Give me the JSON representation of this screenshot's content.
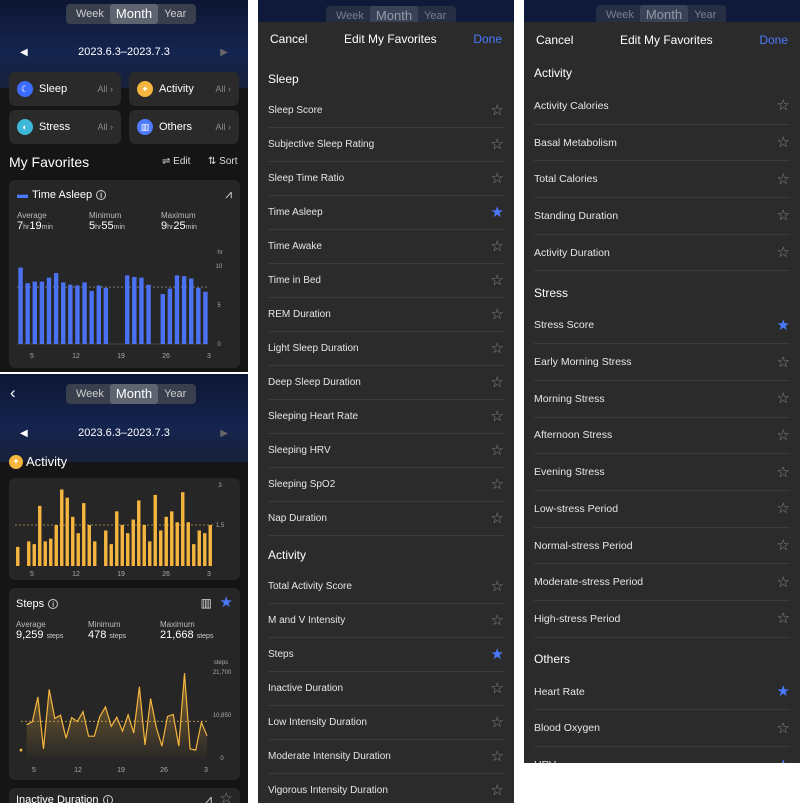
{
  "segments": [
    "Week",
    "Month",
    "Year"
  ],
  "active_segment": "Month",
  "date_range": "2023.6.3–2023.7.3",
  "categories": [
    {
      "label": "Sleep",
      "all": "All",
      "icon": "moon-icon",
      "color": "#3d6dff"
    },
    {
      "label": "Activity",
      "all": "All",
      "icon": "runner-icon",
      "color": "#f5b53f"
    },
    {
      "label": "Stress",
      "all": "All",
      "icon": "stress-icon",
      "color": "#3fb7d9"
    },
    {
      "label": "Others",
      "all": "All",
      "icon": "bars-icon",
      "color": "#4f7bff"
    }
  ],
  "favorites": {
    "title": "My Favorites",
    "edit": "Edit",
    "sort": "Sort"
  },
  "time_asleep": {
    "title": "Time Asleep",
    "average": {
      "label": "Average",
      "h": "7",
      "hr": "hr",
      "m": "19",
      "min": "min"
    },
    "minimum": {
      "label": "Minimum",
      "h": "5",
      "hr": "hr",
      "m": "55",
      "min": "min"
    },
    "maximum": {
      "label": "Maximum",
      "h": "9",
      "hr": "hr",
      "m": "25",
      "min": "min"
    }
  },
  "activity_title": "Activity",
  "steps": {
    "title": "Steps",
    "average": {
      "label": "Average",
      "value": "9,259",
      "unit": "steps"
    },
    "minimum": {
      "label": "Minimum",
      "value": "478",
      "unit": "steps"
    },
    "maximum": {
      "label": "Maximum",
      "value": "21,668",
      "unit": "steps"
    }
  },
  "inactive_title": "Inactive Duration",
  "sheet": {
    "cancel": "Cancel",
    "title": "Edit My Favorites",
    "done": "Done"
  },
  "list_a": [
    {
      "section": "Sleep"
    },
    {
      "label": "Sleep Score",
      "fav": false
    },
    {
      "label": "Subjective Sleep Rating",
      "fav": false
    },
    {
      "label": "Sleep Time Ratio",
      "fav": false
    },
    {
      "label": "Time Asleep",
      "fav": true
    },
    {
      "label": "Time Awake",
      "fav": false
    },
    {
      "label": "Time in Bed",
      "fav": false
    },
    {
      "label": "REM Duration",
      "fav": false
    },
    {
      "label": "Light Sleep Duration",
      "fav": false
    },
    {
      "label": "Deep Sleep Duration",
      "fav": false
    },
    {
      "label": "Sleeping Heart Rate",
      "fav": false
    },
    {
      "label": "Sleeping HRV",
      "fav": false
    },
    {
      "label": "Sleeping SpO2",
      "fav": false
    },
    {
      "label": "Nap Duration",
      "fav": false
    },
    {
      "section": "Activity"
    },
    {
      "label": "Total Activity Score",
      "fav": false
    },
    {
      "label": "M and V Intensity",
      "fav": false
    },
    {
      "label": "Steps",
      "fav": true
    },
    {
      "label": "Inactive Duration",
      "fav": false
    },
    {
      "label": "Low Intensity Duration",
      "fav": false
    },
    {
      "label": "Moderate Intensity Duration",
      "fav": false
    },
    {
      "label": "Vigorous Intensity Duration",
      "fav": false
    }
  ],
  "list_b": [
    {
      "section": "Activity"
    },
    {
      "label": "Activity Calories",
      "fav": false
    },
    {
      "label": "Basal Metabolism",
      "fav": false
    },
    {
      "label": "Total Calories",
      "fav": false
    },
    {
      "label": "Standing Duration",
      "fav": false
    },
    {
      "label": "Activity Duration",
      "fav": false
    },
    {
      "section": "Stress"
    },
    {
      "label": "Stress Score",
      "fav": true
    },
    {
      "label": "Early Morning Stress",
      "fav": false
    },
    {
      "label": "Morning Stress",
      "fav": false
    },
    {
      "label": "Afternoon Stress",
      "fav": false
    },
    {
      "label": "Evening Stress",
      "fav": false
    },
    {
      "label": "Low-stress Period",
      "fav": false
    },
    {
      "label": "Normal-stress Period",
      "fav": false
    },
    {
      "label": "Moderate-stress Period",
      "fav": false
    },
    {
      "label": "High-stress Period",
      "fav": false
    },
    {
      "section": "Others"
    },
    {
      "label": "Heart Rate",
      "fav": true
    },
    {
      "label": "Blood Oxygen",
      "fav": false
    },
    {
      "label": "HRV",
      "fav": true
    }
  ],
  "colors": {
    "accent": "#4a7bff",
    "sleep_bar": "#4a72f0",
    "activity_bar": "#f5b53f",
    "background": "#151515"
  },
  "chart_data": [
    {
      "type": "bar",
      "name": "time-asleep-chart",
      "ylabel": "hr",
      "ylim": [
        0,
        10
      ],
      "yticks": [
        "10",
        "5",
        "0"
      ],
      "xticks": [
        "5",
        "12",
        "19",
        "26",
        "3"
      ],
      "average_line": 7.3,
      "values": [
        9.8,
        7.8,
        8.0,
        8.0,
        8.5,
        9.1,
        7.9,
        7.6,
        7.5,
        7.9,
        6.8,
        7.5,
        7.2,
        0,
        0,
        8.8,
        8.6,
        8.5,
        7.6,
        0,
        6.4,
        7.1,
        8.8,
        8.7,
        8.4,
        7.2,
        6.7
      ],
      "weekday_labels_shown": false
    },
    {
      "type": "bar",
      "name": "activity-chart",
      "ylim": [
        0,
        3
      ],
      "yticks": [
        "3",
        "1.5"
      ],
      "xticks": [
        "5",
        "12",
        "19",
        "26",
        "3"
      ],
      "average_line": 1.5,
      "values": [
        0.7,
        0,
        0.9,
        0.8,
        2.2,
        0.9,
        1.0,
        1.5,
        2.8,
        2.5,
        1.8,
        1.2,
        2.3,
        1.5,
        0.9,
        0,
        1.3,
        0.8,
        2.0,
        1.5,
        1.2,
        1.7,
        2.4,
        1.5,
        0.9,
        2.6,
        1.3,
        1.8,
        2.0,
        1.6,
        2.7,
        1.6,
        0.8,
        1.3,
        1.2,
        1.5
      ]
    },
    {
      "type": "line",
      "name": "steps-chart",
      "ylabel": "steps",
      "ylim": [
        0,
        21700
      ],
      "yticks": [
        "21,700",
        "10,850",
        "0"
      ],
      "xticks": [
        "5",
        "12",
        "19",
        "26",
        "3"
      ],
      "average_line": 9259,
      "values": [
        2000,
        8400,
        9100,
        15400,
        2300,
        17300,
        10000,
        10800,
        5000,
        10200,
        9200,
        11700,
        5500,
        5500,
        10500,
        12900,
        8000,
        10300,
        6800,
        10900,
        6300,
        18000,
        3300,
        15000,
        7700,
        3000,
        10500,
        11000,
        3000,
        21400,
        2300,
        2000,
        9000,
        5600
      ]
    }
  ]
}
